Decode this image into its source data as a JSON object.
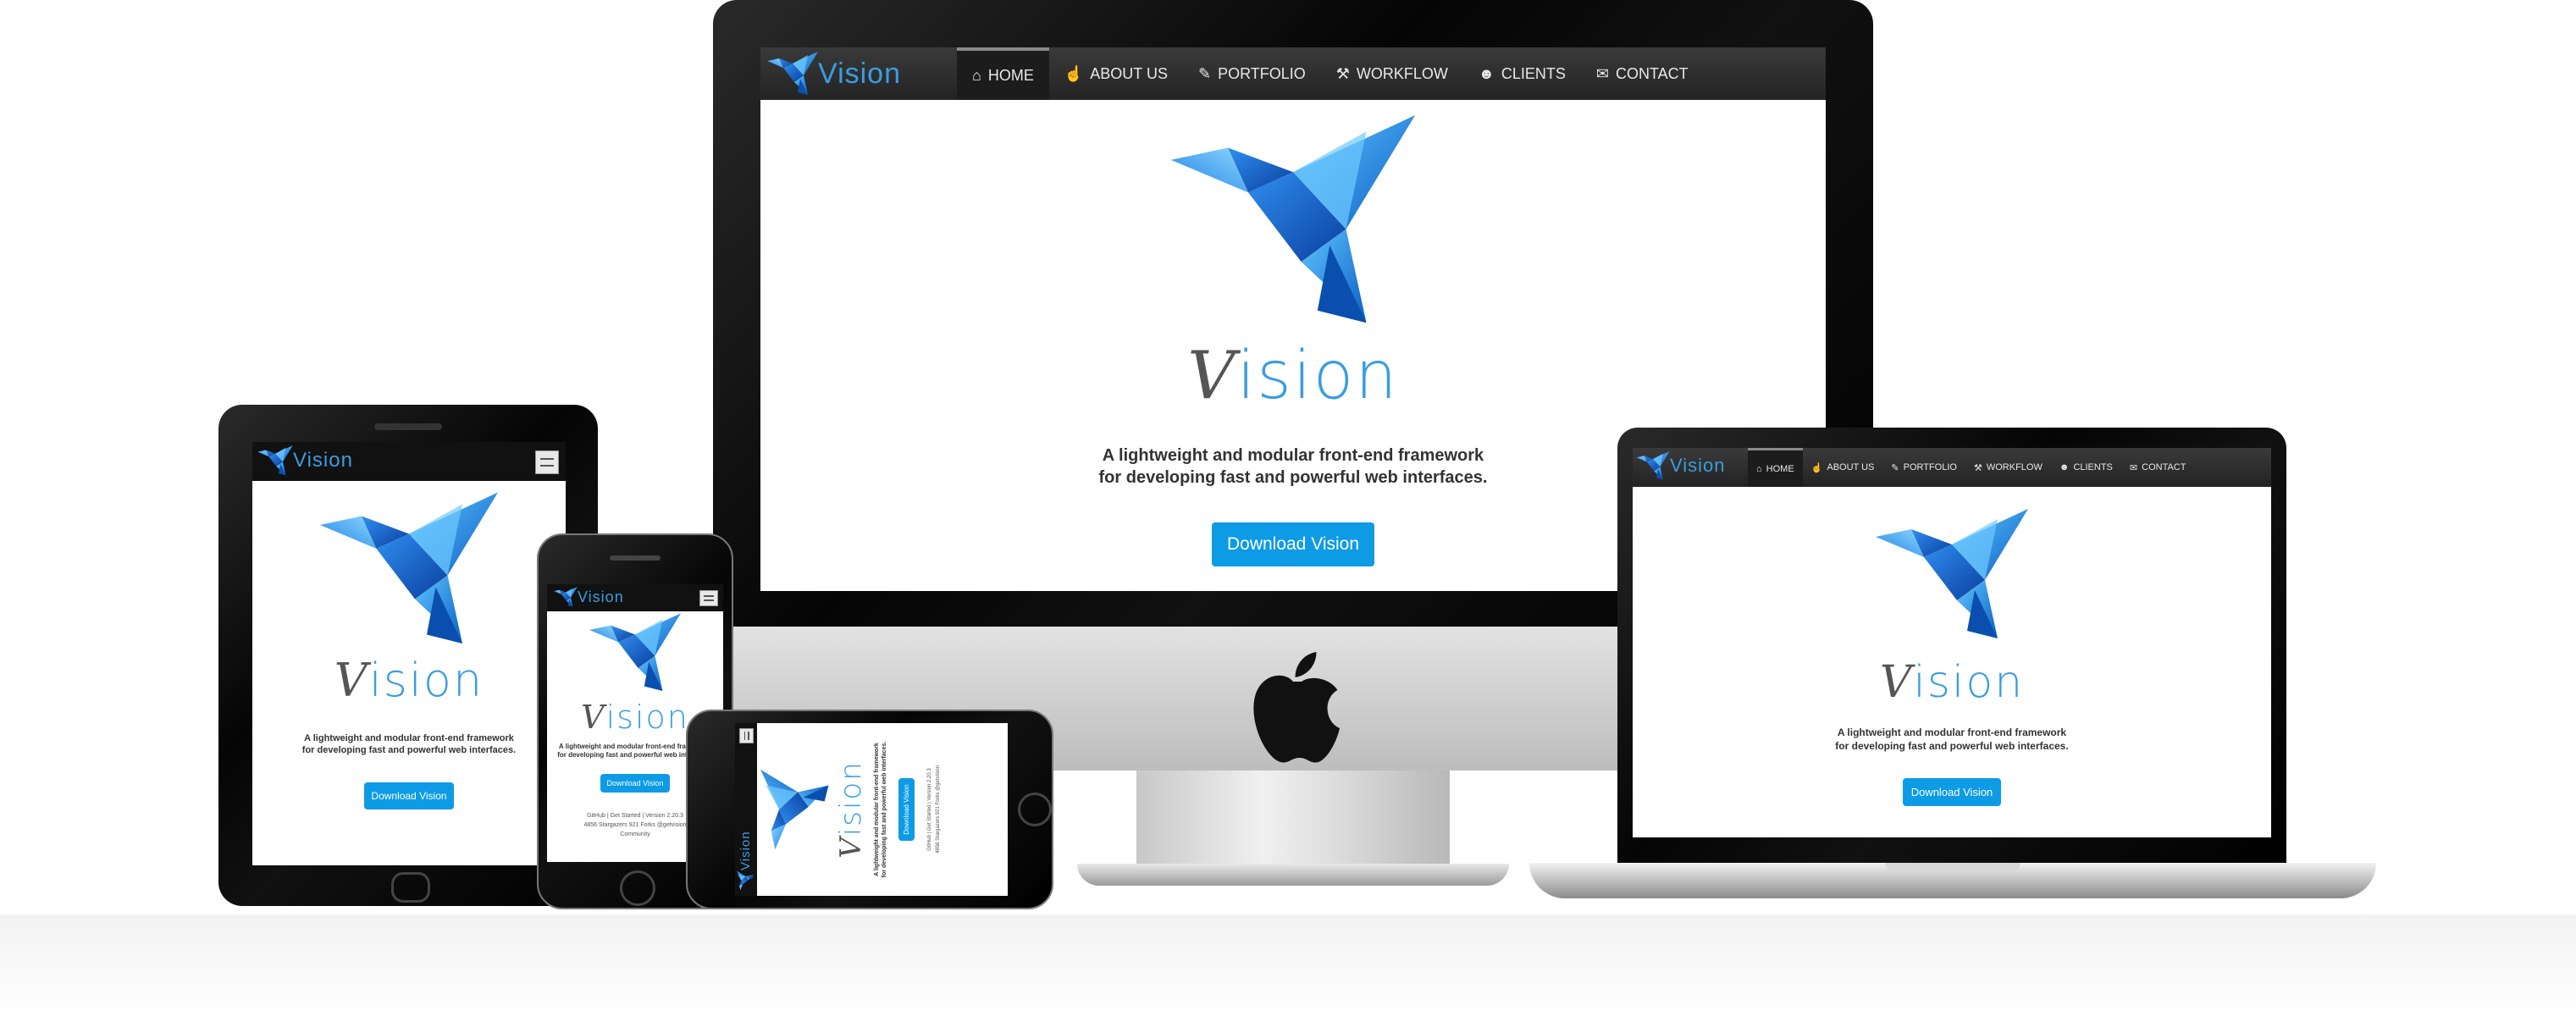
{
  "brand": {
    "name": "Vision",
    "accent": "#3a9de0",
    "button_color": "#0d9be6"
  },
  "nav": {
    "items": [
      {
        "label": "HOME",
        "icon": "home-icon",
        "glyph": "⌂",
        "active": true
      },
      {
        "label": "ABOUT US",
        "icon": "thumbs-up-icon",
        "glyph": "☝",
        "active": false
      },
      {
        "label": "PORTFOLIO",
        "icon": "pencil-icon",
        "glyph": "✎",
        "active": false
      },
      {
        "label": "WORKFLOW",
        "icon": "wrench-icon",
        "glyph": "⚒",
        "active": false
      },
      {
        "label": "CLIENTS",
        "icon": "user-icon",
        "glyph": "☻",
        "active": false
      },
      {
        "label": "CONTACT",
        "icon": "envelope-icon",
        "glyph": "✉",
        "active": false
      }
    ]
  },
  "hero": {
    "title_first": "V",
    "title_rest": "ision",
    "tagline_line1": "A lightweight and modular front-end framework",
    "tagline_line2": "for developing fast and powerful web interfaces.",
    "download_label": "Download Vision"
  },
  "footer": {
    "line1": "GitHub | Get Started | Version 2.20.3",
    "line2": "4856  Stargazers  921 Forks  @getvision",
    "line3": "Community"
  },
  "icons": {
    "logo": "origami-bird-icon",
    "apple": "apple-logo-icon",
    "menu": "hamburger-menu-icon"
  }
}
